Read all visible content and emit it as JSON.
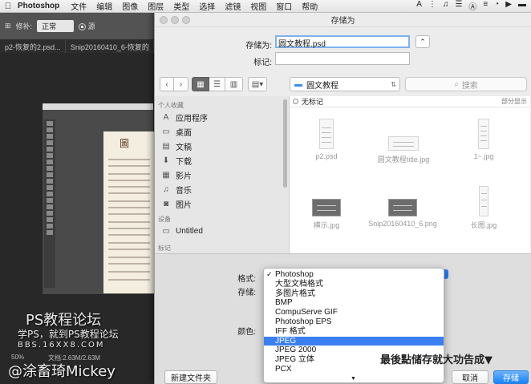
{
  "menubar": {
    "app_name": "Photoshop",
    "items": [
      "文件",
      "编辑",
      "图像",
      "图层",
      "类型",
      "选择",
      "滤镜",
      "视图",
      "窗口",
      "帮助"
    ],
    "status_icons": [
      "A",
      "⋮",
      "♫",
      "☰",
      "Ⓐ",
      "≡",
      "◔",
      "▶",
      "▬"
    ]
  },
  "photoshop": {
    "options_label": "修补:",
    "options_select": "正常",
    "options_radio_label": "源",
    "tabs": [
      "p2-恢复的2.psd...",
      "Snip20160410_6-恢复的"
    ],
    "status_zoom": "50%",
    "status_doc": "文档:2.63M/2.63M"
  },
  "watermark": {
    "line1": "PS教程论坛",
    "line2": "学PS，就到PS教程论坛",
    "line3": "BBS.16XX8.COM",
    "line4": "@涂畜琦Mickey"
  },
  "dialog": {
    "title": "存储为",
    "save_as_label": "存储为:",
    "filename": "圆文教程.psd",
    "tags_label": "标记:",
    "tags_value": "",
    "location": "圆文教程",
    "search_placeholder": "搜索",
    "sidebar": {
      "favorites_header": "个人收藏",
      "favorites": [
        {
          "icon": "applications-icon",
          "label": "应用程序"
        },
        {
          "icon": "desktop-icon",
          "label": "桌面"
        },
        {
          "icon": "documents-icon",
          "label": "文稿"
        },
        {
          "icon": "downloads-icon",
          "label": "下载"
        },
        {
          "icon": "movies-icon",
          "label": "影片"
        },
        {
          "icon": "music-icon",
          "label": "音乐"
        },
        {
          "icon": "pictures-icon",
          "label": "图片"
        }
      ],
      "devices_header": "设备",
      "devices": [
        {
          "icon": "disk-icon",
          "label": "Untitled"
        }
      ],
      "tags_header": "标记"
    },
    "file_list": {
      "tag_header": "无标记",
      "section_right": "部分显示",
      "files": [
        {
          "name": "p2.psd",
          "dark": false
        },
        {
          "name": "圆文教程title.jpg",
          "dark": false
        },
        {
          "name": "1~.jpg",
          "dark": false
        },
        {
          "name": "横示.jpg",
          "dark": true
        },
        {
          "name": "Snip20160410_6.png",
          "dark": true
        },
        {
          "name": "长图.jpg",
          "dark": false
        }
      ]
    },
    "format_label": "格式:",
    "save_label": "存储:",
    "color_label": "颜色:",
    "new_folder_button": "新建文件夹",
    "cancel_button": "取消",
    "save_button": "存储",
    "format_options": [
      {
        "label": "Photoshop",
        "checked": true,
        "selected": false
      },
      {
        "label": "大型文档格式",
        "checked": false,
        "selected": false
      },
      {
        "label": "多图片格式",
        "checked": false,
        "selected": false
      },
      {
        "label": "BMP",
        "checked": false,
        "selected": false
      },
      {
        "label": "CompuServe GIF",
        "checked": false,
        "selected": false
      },
      {
        "label": "Photoshop EPS",
        "checked": false,
        "selected": false
      },
      {
        "label": "IFF 格式",
        "checked": false,
        "selected": false
      },
      {
        "label": "JPEG",
        "checked": false,
        "selected": true
      },
      {
        "label": "JPEG 2000",
        "checked": false,
        "selected": false
      },
      {
        "label": "JPEG 立体",
        "checked": false,
        "selected": false
      },
      {
        "label": "PCX",
        "checked": false,
        "selected": false
      }
    ]
  },
  "overlay_caption": "最後點储存就大功告成▼"
}
